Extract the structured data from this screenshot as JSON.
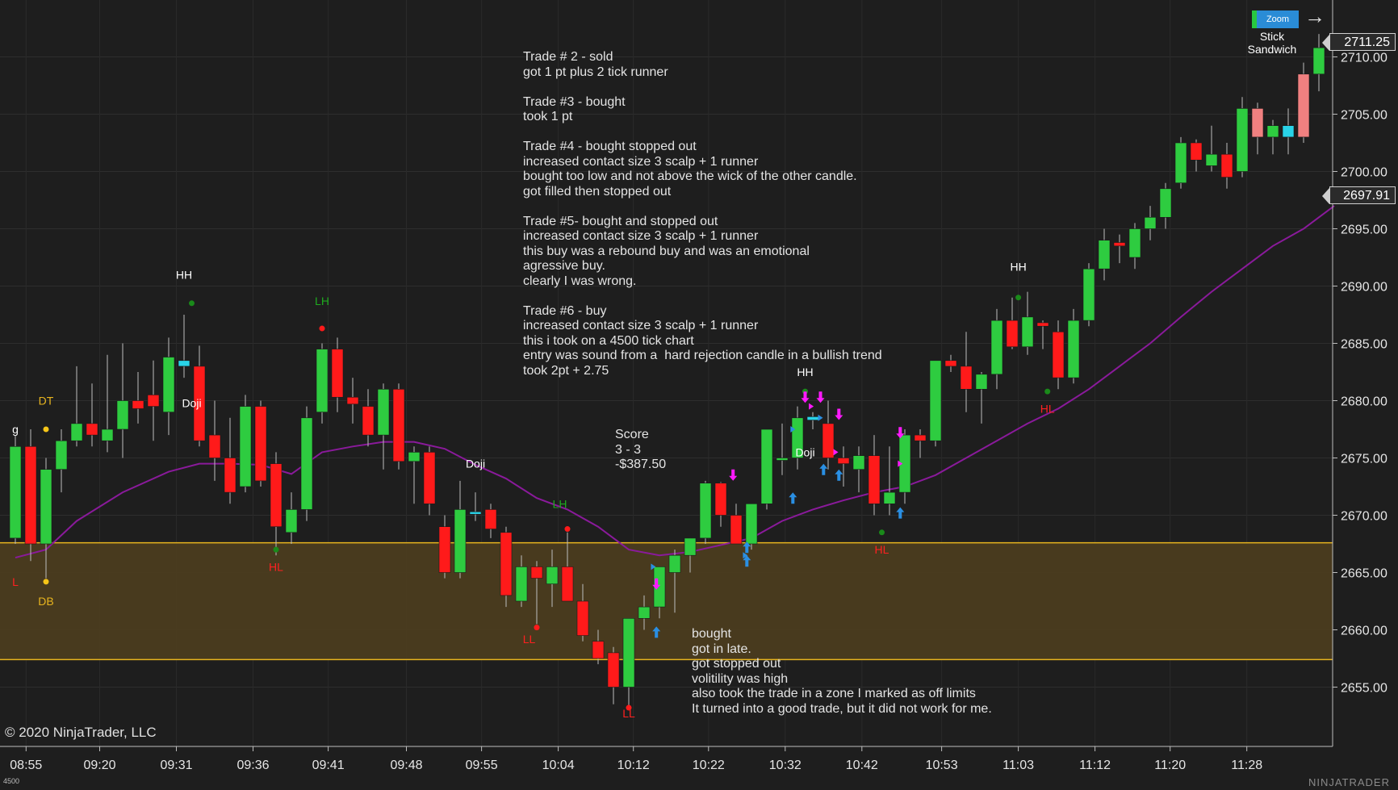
{
  "app": {
    "copyright": "© 2020 NinjaTrader, LLC",
    "tick_type": "4500",
    "brand": "NINJATRADER",
    "zoom_button": "Zoom",
    "widget_label_line1": "Stick",
    "widget_label_line2": "Sandwich",
    "last_price_badge": "2711.25",
    "ma_price_badge": "2697.91"
  },
  "notes": {
    "top_block": [
      "Trade # 2 - sold",
      "got 1 pt plus 2 tick runner",
      "",
      "Trade #3 - bought",
      "took 1 pt",
      "",
      "Trade #4 - bought stopped out",
      "increased contact size 3 scalp + 1 runner",
      "bought too low and not above the wick of the other candle.",
      "got filled then stopped out",
      "",
      "Trade #5- bought and stopped out",
      "increased contact size 3 scalp + 1 runner",
      "this buy was a rebound buy and was an emotional",
      "agressive buy.",
      "clearly I was wrong.",
      "",
      "Trade #6 - buy",
      "increased contact size 3 scalp + 1 runner",
      "this i took on a 4500 tick chart",
      "entry was sound from a  hard rejection candle in a bullish trend",
      "took 2pt + 2.75"
    ],
    "score_block": [
      "Score",
      "3 - 3",
      "-$387.50"
    ],
    "bottom_block": [
      "bought",
      "got in late.",
      "got stopped out",
      "volitility was high",
      "also took the trade in a zone I marked as off limits",
      "It turned into a good trade, but it did not work for me."
    ]
  },
  "colors": {
    "background": "#1e1e1e",
    "bull": "#2ecc40",
    "bear": "#ff1a1a",
    "pink": "#f08080",
    "doji": "#29d3e8",
    "ma": "#8a1a9b",
    "zone_fill": "#4d3d1e",
    "zone_line": "#e7b41e",
    "buy_arrow": "#2a8fe3",
    "sell_arrow": "#ff19ff"
  },
  "chart_data": {
    "type": "candlestick",
    "ylim": [
      2650.5,
      2713.5
    ],
    "y_ticks": [
      "2710.00",
      "2705.00",
      "2700.00",
      "2695.00",
      "2690.00",
      "2685.00",
      "2680.00",
      "2675.00",
      "2670.00",
      "2665.00",
      "2660.00",
      "2655.00"
    ],
    "y_tick_values": [
      2710,
      2705,
      2700,
      2695,
      2690,
      2685,
      2680,
      2675,
      2670,
      2665,
      2660,
      2655
    ],
    "x_ticks": [
      "08:55",
      "09:20",
      "09:31",
      "09:36",
      "09:41",
      "09:48",
      "09:55",
      "10:04",
      "10:12",
      "10:22",
      "10:32",
      "10:42",
      "10:53",
      "11:03",
      "11:12",
      "11:20",
      "11:28"
    ],
    "x_tick_bars": [
      0.7,
      5.5,
      10.5,
      15.5,
      20.4,
      25.5,
      30.4,
      35.4,
      40.3,
      45.2,
      50.2,
      55.2,
      60.4,
      65.4,
      70.4,
      75.3,
      80.3
    ],
    "zone": {
      "low": 2657.4,
      "high": 2667.6
    },
    "candles": [
      {
        "o": 2668.0,
        "h": 2677.0,
        "l": 2667.5,
        "c": 2676.0
      },
      {
        "o": 2676.0,
        "h": 2677.5,
        "l": 2666.0,
        "c": 2667.5
      },
      {
        "o": 2667.5,
        "h": 2675.0,
        "l": 2664.5,
        "c": 2674.0
      },
      {
        "o": 2674.0,
        "h": 2677.5,
        "l": 2672.0,
        "c": 2676.5
      },
      {
        "o": 2676.5,
        "h": 2683.0,
        "l": 2676.0,
        "c": 2678.0
      },
      {
        "o": 2678.0,
        "h": 2681.5,
        "l": 2676.0,
        "c": 2677.0
      },
      {
        "o": 2676.5,
        "h": 2684.0,
        "l": 2675.5,
        "c": 2677.5
      },
      {
        "o": 2677.5,
        "h": 2685.0,
        "l": 2675.0,
        "c": 2680.0
      },
      {
        "o": 2680.0,
        "h": 2682.5,
        "l": 2678.0,
        "c": 2679.3
      },
      {
        "o": 2680.5,
        "h": 2683.5,
        "l": 2676.5,
        "c": 2679.5
      },
      {
        "o": 2679.0,
        "h": 2685.5,
        "l": 2677.0,
        "c": 2683.8
      },
      {
        "o": 2683.5,
        "h": 2687.5,
        "l": 2682.0,
        "c": 2683.0
      },
      {
        "o": 2683.0,
        "h": 2684.8,
        "l": 2676.0,
        "c": 2676.5
      },
      {
        "o": 2677.0,
        "h": 2680.0,
        "l": 2673.0,
        "c": 2675.0
      },
      {
        "o": 2675.0,
        "h": 2678.5,
        "l": 2671.0,
        "c": 2672.0
      },
      {
        "o": 2672.5,
        "h": 2680.5,
        "l": 2672.0,
        "c": 2679.5
      },
      {
        "o": 2679.5,
        "h": 2680.0,
        "l": 2672.5,
        "c": 2673.0
      },
      {
        "o": 2674.5,
        "h": 2675.5,
        "l": 2666.5,
        "c": 2669.0
      },
      {
        "o": 2668.5,
        "h": 2672.0,
        "l": 2667.5,
        "c": 2670.5
      },
      {
        "o": 2670.5,
        "h": 2679.5,
        "l": 2669.5,
        "c": 2678.5
      },
      {
        "o": 2679.0,
        "h": 2685.0,
        "l": 2678.0,
        "c": 2684.5
      },
      {
        "o": 2684.5,
        "h": 2685.5,
        "l": 2679.0,
        "c": 2680.3
      },
      {
        "o": 2680.3,
        "h": 2682.0,
        "l": 2678.0,
        "c": 2679.7
      },
      {
        "o": 2679.5,
        "h": 2681.0,
        "l": 2676.0,
        "c": 2677.0
      },
      {
        "o": 2677.0,
        "h": 2681.5,
        "l": 2674.0,
        "c": 2681.0
      },
      {
        "o": 2681.0,
        "h": 2681.5,
        "l": 2674.0,
        "c": 2674.7
      },
      {
        "o": 2674.7,
        "h": 2676.0,
        "l": 2671.0,
        "c": 2675.5
      },
      {
        "o": 2675.5,
        "h": 2676.0,
        "l": 2670.0,
        "c": 2671.0
      },
      {
        "o": 2669.0,
        "h": 2670.0,
        "l": 2664.5,
        "c": 2665.0
      },
      {
        "o": 2665.0,
        "h": 2673.0,
        "l": 2664.5,
        "c": 2670.5
      },
      {
        "o": 2670.3,
        "h": 2672.0,
        "l": 2669.5,
        "c": 2670.1
      },
      {
        "o": 2670.5,
        "h": 2671.0,
        "l": 2668.0,
        "c": 2668.8
      },
      {
        "o": 2668.5,
        "h": 2669.0,
        "l": 2662.0,
        "c": 2663.0
      },
      {
        "o": 2662.5,
        "h": 2666.5,
        "l": 2662.0,
        "c": 2665.5
      },
      {
        "o": 2665.5,
        "h": 2666.0,
        "l": 2660.5,
        "c": 2664.5
      },
      {
        "o": 2664.0,
        "h": 2667.0,
        "l": 2662.0,
        "c": 2665.5
      },
      {
        "o": 2665.5,
        "h": 2668.5,
        "l": 2662.5,
        "c": 2662.5
      },
      {
        "o": 2662.5,
        "h": 2664.0,
        "l": 2659.0,
        "c": 2659.5
      },
      {
        "o": 2659.0,
        "h": 2660.0,
        "l": 2657.0,
        "c": 2657.5
      },
      {
        "o": 2658.0,
        "h": 2658.5,
        "l": 2653.5,
        "c": 2655.0
      },
      {
        "o": 2655.0,
        "h": 2661.0,
        "l": 2653.0,
        "c": 2661.0
      },
      {
        "o": 2661.0,
        "h": 2663.0,
        "l": 2660.0,
        "c": 2662.0
      },
      {
        "o": 2662.0,
        "h": 2665.5,
        "l": 2661.0,
        "c": 2665.5
      },
      {
        "o": 2665.0,
        "h": 2667.0,
        "l": 2661.5,
        "c": 2666.5
      },
      {
        "o": 2666.5,
        "h": 2668.0,
        "l": 2665.0,
        "c": 2668.0
      },
      {
        "o": 2668.0,
        "h": 2673.0,
        "l": 2667.5,
        "c": 2672.8
      },
      {
        "o": 2672.8,
        "h": 2672.9,
        "l": 2669.0,
        "c": 2670.0
      },
      {
        "o": 2670.0,
        "h": 2671.0,
        "l": 2667.5,
        "c": 2667.5
      },
      {
        "o": 2667.5,
        "h": 2671.0,
        "l": 2667.0,
        "c": 2671.0
      },
      {
        "o": 2671.0,
        "h": 2677.5,
        "l": 2670.5,
        "c": 2677.5
      },
      {
        "o": 2675.0,
        "h": 2678.0,
        "l": 2673.5,
        "c": 2675.0
      },
      {
        "o": 2675.0,
        "h": 2679.5,
        "l": 2674.0,
        "c": 2678.5
      },
      {
        "o": 2678.6,
        "h": 2679.0,
        "l": 2677.5,
        "c": 2678.3
      },
      {
        "o": 2678.0,
        "h": 2680.0,
        "l": 2674.0,
        "c": 2675.0
      },
      {
        "o": 2675.0,
        "h": 2676.0,
        "l": 2672.5,
        "c": 2674.5
      },
      {
        "o": 2674.0,
        "h": 2676.0,
        "l": 2672.0,
        "c": 2675.2
      },
      {
        "o": 2675.2,
        "h": 2677.0,
        "l": 2670.0,
        "c": 2671.0
      },
      {
        "o": 2671.0,
        "h": 2676.0,
        "l": 2670.0,
        "c": 2672.0
      },
      {
        "o": 2672.0,
        "h": 2677.5,
        "l": 2671.0,
        "c": 2677.0
      },
      {
        "o": 2677.0,
        "h": 2677.5,
        "l": 2675.0,
        "c": 2676.5
      },
      {
        "o": 2676.5,
        "h": 2683.5,
        "l": 2676.0,
        "c": 2683.5
      },
      {
        "o": 2683.5,
        "h": 2684.0,
        "l": 2682.5,
        "c": 2683.0
      },
      {
        "o": 2683.0,
        "h": 2686.0,
        "l": 2679.0,
        "c": 2681.0
      },
      {
        "o": 2681.0,
        "h": 2682.5,
        "l": 2678.0,
        "c": 2682.3
      },
      {
        "o": 2682.3,
        "h": 2688.0,
        "l": 2681.0,
        "c": 2687.0
      },
      {
        "o": 2687.0,
        "h": 2689.0,
        "l": 2684.5,
        "c": 2684.7
      },
      {
        "o": 2684.7,
        "h": 2689.5,
        "l": 2684.0,
        "c": 2687.3
      },
      {
        "o": 2686.8,
        "h": 2687.0,
        "l": 2684.5,
        "c": 2686.5
      },
      {
        "o": 2686.0,
        "h": 2687.0,
        "l": 2681.0,
        "c": 2682.0
      },
      {
        "o": 2682.0,
        "h": 2688.0,
        "l": 2681.5,
        "c": 2687.0
      },
      {
        "o": 2687.0,
        "h": 2692.0,
        "l": 2686.5,
        "c": 2691.5
      },
      {
        "o": 2691.5,
        "h": 2695.0,
        "l": 2690.5,
        "c": 2694.0
      },
      {
        "o": 2693.8,
        "h": 2694.5,
        "l": 2692.0,
        "c": 2693.5
      },
      {
        "o": 2692.5,
        "h": 2695.5,
        "l": 2691.5,
        "c": 2695.0
      },
      {
        "o": 2695.0,
        "h": 2697.0,
        "l": 2694.0,
        "c": 2696.0
      },
      {
        "o": 2696.0,
        "h": 2699.0,
        "l": 2695.0,
        "c": 2698.5
      },
      {
        "o": 2699.0,
        "h": 2703.0,
        "l": 2698.5,
        "c": 2702.5
      },
      {
        "o": 2702.5,
        "h": 2702.8,
        "l": 2700.0,
        "c": 2701.0
      },
      {
        "o": 2700.5,
        "h": 2704.0,
        "l": 2700.0,
        "c": 2701.5
      },
      {
        "o": 2701.5,
        "h": 2702.5,
        "l": 2698.5,
        "c": 2699.5
      },
      {
        "o": 2700.0,
        "h": 2706.5,
        "l": 2699.5,
        "c": 2705.5
      },
      {
        "o": 2705.5,
        "h": 2706.0,
        "l": 2701.5,
        "c": 2703.0
      },
      {
        "o": 2703.0,
        "h": 2704.5,
        "l": 2701.5,
        "c": 2704.0
      },
      {
        "o": 2704.0,
        "h": 2705.5,
        "l": 2701.5,
        "c": 2703.0
      },
      {
        "o": 2703.0,
        "h": 2709.5,
        "l": 2702.5,
        "c": 2708.5
      },
      {
        "o": 2708.5,
        "h": 2712.0,
        "l": 2707.0,
        "c": 2710.8
      }
    ],
    "special_colors": {
      "doji": [
        11,
        30,
        52,
        83
      ],
      "pink": [
        81,
        84
      ]
    },
    "moving_average": [
      [
        0,
        2666.3
      ],
      [
        2,
        2667.0
      ],
      [
        4,
        2669.5
      ],
      [
        7,
        2672.0
      ],
      [
        10,
        2673.8
      ],
      [
        12,
        2674.5
      ],
      [
        14,
        2674.5
      ],
      [
        16,
        2674.4
      ],
      [
        18,
        2673.6
      ],
      [
        20,
        2675.5
      ],
      [
        22,
        2676.0
      ],
      [
        24,
        2676.4
      ],
      [
        26,
        2676.4
      ],
      [
        28,
        2675.8
      ],
      [
        30,
        2674.4
      ],
      [
        32,
        2673.2
      ],
      [
        34,
        2671.5
      ],
      [
        36,
        2670.5
      ],
      [
        38,
        2669.0
      ],
      [
        40,
        2667.0
      ],
      [
        42,
        2666.5
      ],
      [
        44,
        2666.8
      ],
      [
        46,
        2667.4
      ],
      [
        48,
        2668.0
      ],
      [
        50,
        2669.5
      ],
      [
        52,
        2670.5
      ],
      [
        54,
        2671.3
      ],
      [
        56,
        2672.0
      ],
      [
        58,
        2672.5
      ],
      [
        60,
        2673.5
      ],
      [
        62,
        2675.0
      ],
      [
        64,
        2676.5
      ],
      [
        66,
        2678.0
      ],
      [
        68,
        2679.3
      ],
      [
        70,
        2681.0
      ],
      [
        72,
        2683.0
      ],
      [
        74,
        2685.0
      ],
      [
        76,
        2687.3
      ],
      [
        78,
        2689.5
      ],
      [
        80,
        2691.5
      ],
      [
        82,
        2693.5
      ],
      [
        84,
        2695.0
      ],
      [
        85,
        2696.0
      ],
      [
        86,
        2697.0
      ]
    ],
    "labels": [
      {
        "text": "g",
        "bar": 0,
        "price": 2677.5,
        "color": "#ffffff"
      },
      {
        "text": "DT",
        "bar": 2,
        "price": 2680.0,
        "color": "#e7b41e"
      },
      {
        "text": "DB",
        "bar": 2,
        "price": 2662.5,
        "color": "#e7b41e"
      },
      {
        "text": "L",
        "bar": 0,
        "price": 2664.2,
        "color": "#ff2020"
      },
      {
        "text": "HH",
        "bar": 11,
        "price": 2691.0,
        "color": "#ffffff"
      },
      {
        "text": "Doji",
        "bar": 11.5,
        "price": 2679.8,
        "color": "#ffffff"
      },
      {
        "text": "LH",
        "bar": 20,
        "price": 2688.7,
        "color": "#1faa1f"
      },
      {
        "text": "HL",
        "bar": 17,
        "price": 2665.5,
        "color": "#ff2020"
      },
      {
        "text": "Doji",
        "bar": 30,
        "price": 2674.5,
        "color": "#ffffff"
      },
      {
        "text": "LH",
        "bar": 35.5,
        "price": 2671.0,
        "color": "#1faa1f"
      },
      {
        "text": "LL",
        "bar": 33.5,
        "price": 2659.2,
        "color": "#ff2020"
      },
      {
        "text": "LL",
        "bar": 40,
        "price": 2652.7,
        "color": "#ff2020"
      },
      {
        "text": "HH",
        "bar": 51.5,
        "price": 2682.5,
        "color": "#ffffff"
      },
      {
        "text": "Doji",
        "bar": 51.5,
        "price": 2675.5,
        "color": "#ffffff"
      },
      {
        "text": "HL",
        "bar": 56.5,
        "price": 2667.0,
        "color": "#ff2020"
      },
      {
        "text": "HH",
        "bar": 65.4,
        "price": 2691.7,
        "color": "#ffffff"
      },
      {
        "text": "HL",
        "bar": 67.3,
        "price": 2679.3,
        "color": "#ff2020"
      }
    ],
    "dots": [
      {
        "bar": 2,
        "price": 2677.5,
        "color": "#f5c518"
      },
      {
        "bar": 2,
        "price": 2664.2,
        "color": "#f5c518"
      },
      {
        "bar": 11.5,
        "price": 2688.5,
        "color": "#1a8a1a"
      },
      {
        "bar": 20,
        "price": 2686.3,
        "color": "#ff1a1a"
      },
      {
        "bar": 17,
        "price": 2667.0,
        "color": "#1a8a1a"
      },
      {
        "bar": 34,
        "price": 2660.2,
        "color": "#ff1a1a"
      },
      {
        "bar": 36,
        "price": 2668.8,
        "color": "#ff1a1a"
      },
      {
        "bar": 40,
        "price": 2653.2,
        "color": "#ff1a1a"
      },
      {
        "bar": 51.5,
        "price": 2680.8,
        "color": "#1a8a1a"
      },
      {
        "bar": 56.5,
        "price": 2668.5,
        "color": "#1a8a1a"
      },
      {
        "bar": 65.4,
        "price": 2689.0,
        "color": "#1a8a1a"
      },
      {
        "bar": 67.3,
        "price": 2680.8,
        "color": "#1a8a1a"
      }
    ],
    "buy_arrows": [
      [
        41.8,
        2659.8
      ],
      [
        47.7,
        2666.0
      ],
      [
        47.7,
        2667.2
      ],
      [
        50.7,
        2671.5
      ],
      [
        52.7,
        2674.0
      ],
      [
        53.7,
        2673.5
      ],
      [
        57.7,
        2670.2
      ]
    ],
    "sell_arrows": [
      [
        41.8,
        2664.0
      ],
      [
        46.8,
        2673.5
      ],
      [
        51.5,
        2680.3
      ],
      [
        52.5,
        2680.3
      ],
      [
        53.7,
        2678.8
      ],
      [
        57.7,
        2677.2
      ]
    ],
    "small_markers": [
      [
        50.7,
        2677.5,
        "#2a8fe3"
      ],
      [
        51.9,
        2679.5,
        "#ff19ff"
      ],
      [
        52.5,
        2678.5,
        "#2a8fe3"
      ],
      [
        53.5,
        2675.5,
        "#ff19ff"
      ],
      [
        57.7,
        2674.5,
        "#ff19ff"
      ],
      [
        47.6,
        2666.5,
        "#2a8fe3"
      ],
      [
        41.6,
        2665.5,
        "#2a8fe3"
      ]
    ]
  }
}
